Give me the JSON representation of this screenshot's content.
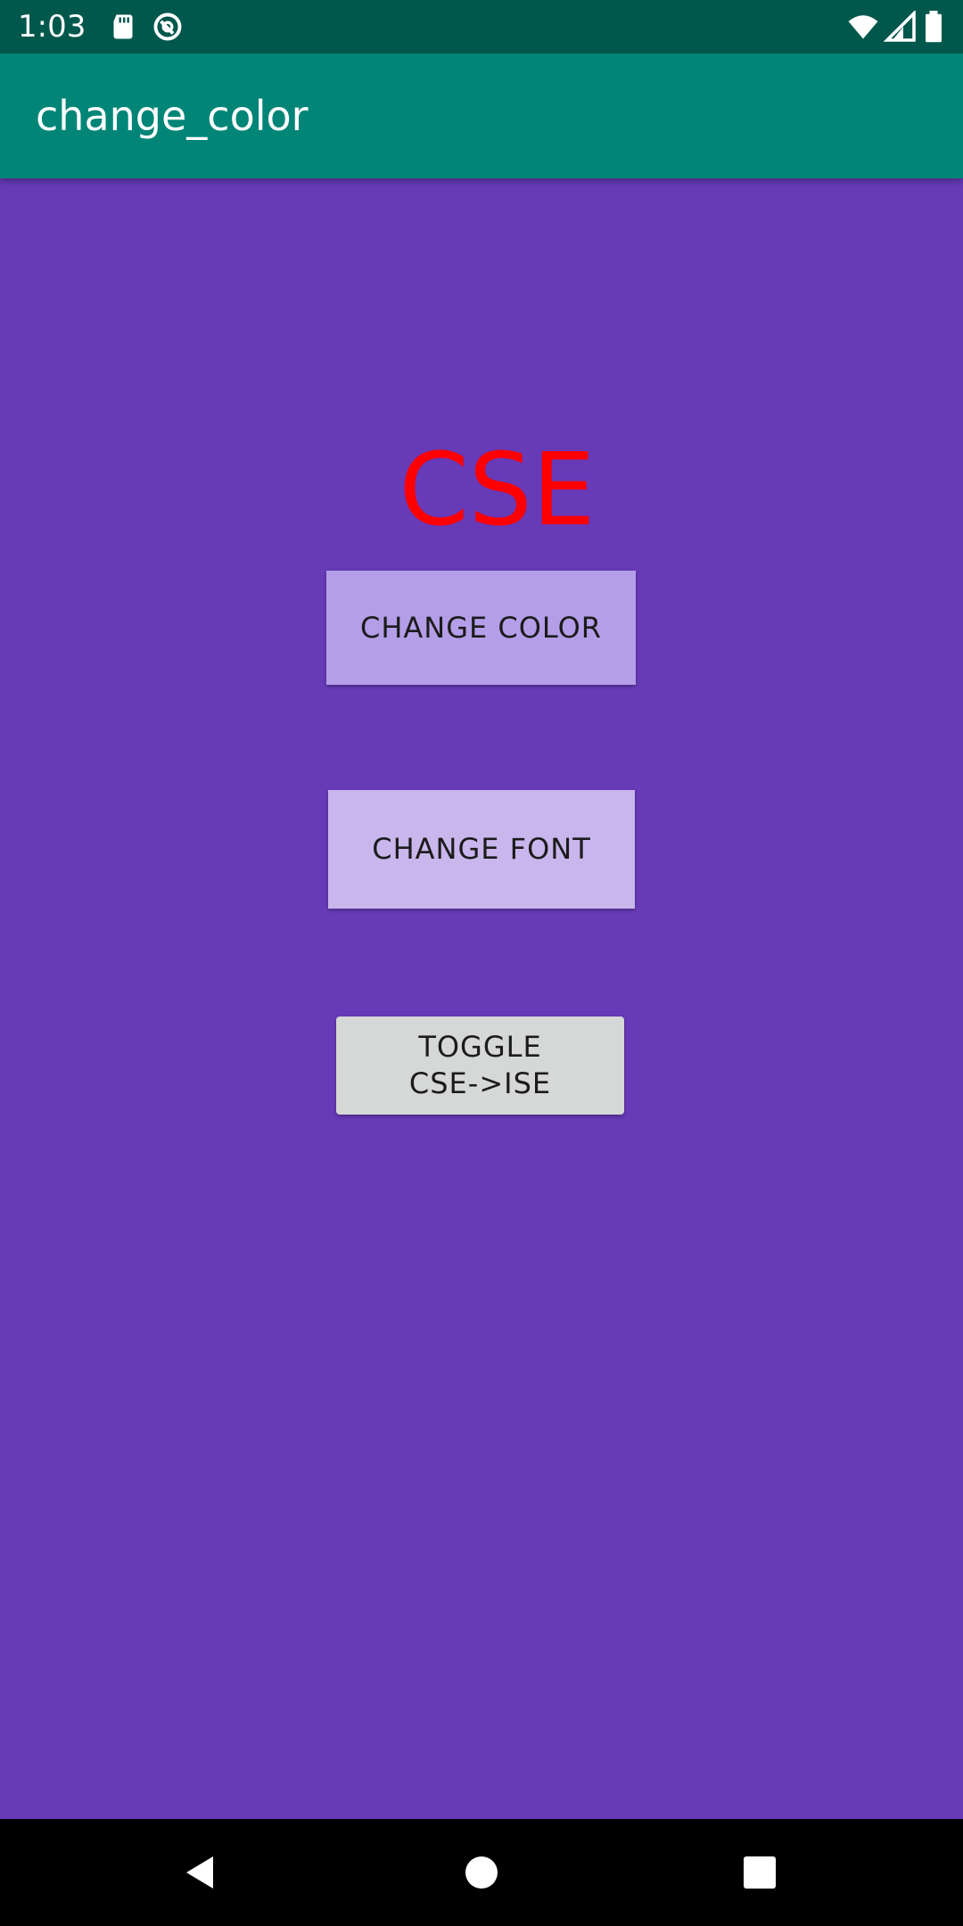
{
  "status_bar": {
    "time": "1:03",
    "icons": [
      "sd-card-icon",
      "sync-icon",
      "wifi-icon",
      "signal-icon",
      "battery-icon"
    ]
  },
  "app_bar": {
    "title": "change_color",
    "color": "#008577",
    "status_color": "#00574b"
  },
  "main": {
    "background": "#673ab7",
    "display_text": "CSE",
    "display_text_color": "#ff0000",
    "buttons": {
      "change_color": "CHANGE COLOR",
      "change_font": "CHANGE FONT",
      "toggle_line1": "TOGGLE",
      "toggle_line2": "CSE->ISE"
    }
  },
  "nav_bar": {
    "icons": [
      "back-icon",
      "home-icon",
      "recents-icon"
    ]
  }
}
